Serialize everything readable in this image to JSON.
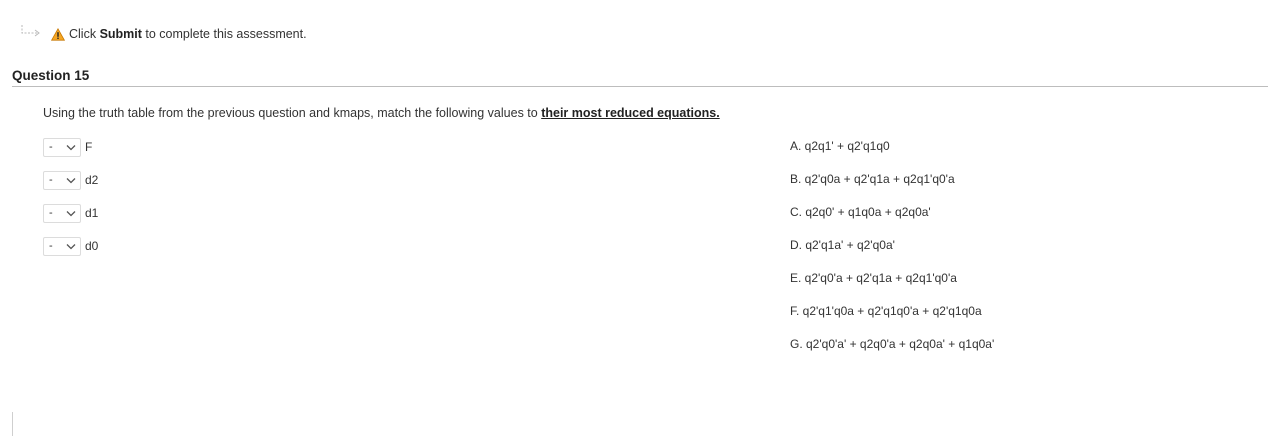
{
  "notice": {
    "prefix": "Click ",
    "emphasis": "Submit",
    "suffix": " to complete this assessment."
  },
  "question": {
    "title": "Question 15",
    "prompt_text": "Using the truth table from the previous question and kmaps, match the following values to ",
    "prompt_emphasis": "their most reduced equations."
  },
  "matches": [
    {
      "selected": "-",
      "label": "F"
    },
    {
      "selected": "-",
      "label": "d2"
    },
    {
      "selected": "-",
      "label": "d1"
    },
    {
      "selected": "-",
      "label": "d0"
    }
  ],
  "answers": [
    "A. q2q1' + q2'q1q0",
    "B. q2'q0a + q2'q1a + q2q1'q0'a",
    "C. q2q0' + q1q0a + q2q0a'",
    "D. q2'q1a' + q2'q0a'",
    "E. q2'q0'a + q2'q1a + q2q1'q0'a",
    "F. q2'q1'q0a + q2'q1q0'a + q2'q1q0a",
    "G. q2'q0'a' + q2q0'a + q2q0a' + q1q0a'"
  ],
  "colors": {
    "warning_fill": "#f5a623",
    "rule": "#bdbdbd",
    "text": "#333333"
  }
}
